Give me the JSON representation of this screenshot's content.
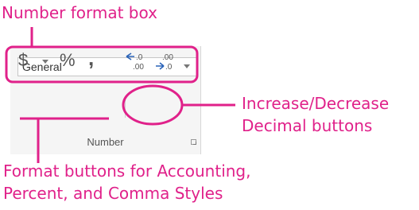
{
  "annotations": {
    "number_format_box": "Number format box",
    "increase_decrease_line1": "Increase/Decrease",
    "increase_decrease_line2": "Decimal buttons",
    "format_buttons_line1": "Format buttons for Accounting,",
    "format_buttons_line2": "Percent, and Comma Styles"
  },
  "ribbon_group": {
    "number_format": {
      "selected": "General"
    },
    "accounting_symbol": "$",
    "percent_symbol": "%",
    "comma_symbol": ",",
    "group_label": "Number",
    "increase_decimal_icon": "increase-decimal-icon",
    "decrease_decimal_icon": "decrease-decimal-icon"
  },
  "colors": {
    "annotation": "#e0218a",
    "ribbon_background": "#f5f5f5",
    "icon_blue": "#2a63b8",
    "icon_gray": "#555555"
  }
}
